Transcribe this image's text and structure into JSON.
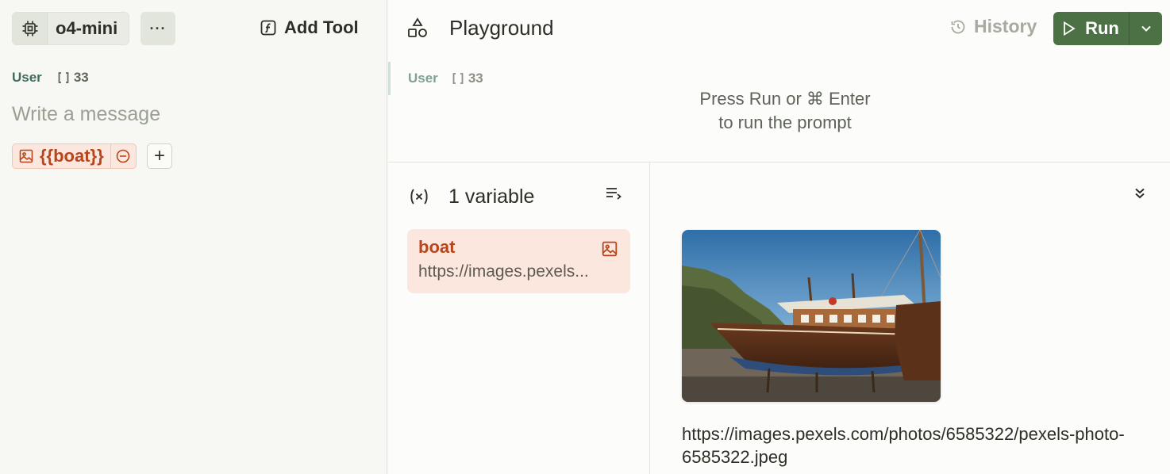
{
  "left": {
    "model_name": "o4-mini",
    "more_label": "···",
    "add_tool_label": "Add Tool",
    "role": "User",
    "token_count": "33",
    "message_placeholder": "Write a message",
    "variable_chip": "{{boat}}",
    "add_part_label": "+"
  },
  "header": {
    "title": "Playground",
    "history_label": "History",
    "run_label": "Run"
  },
  "response": {
    "role": "User",
    "token_count": "33",
    "hint_line1": "Press Run or ⌘ Enter",
    "hint_line2": "to run the prompt"
  },
  "variables": {
    "count_label": "1 variable",
    "items": [
      {
        "name": "boat",
        "value": "https://images.pexels.com/photos/6585322/pexels-photo-6585322.jpeg",
        "value_display": "https://images.pexels..."
      }
    ]
  },
  "preview": {
    "url": "https://images.pexels.com/photos/6585322/pexels-photo-6585322.jpeg",
    "image_desc": "photo-of-wooden-boat"
  },
  "colors": {
    "accent_green": "#4c7144",
    "variable_orange": "#b8451b",
    "variable_bg": "#fbe7de"
  }
}
